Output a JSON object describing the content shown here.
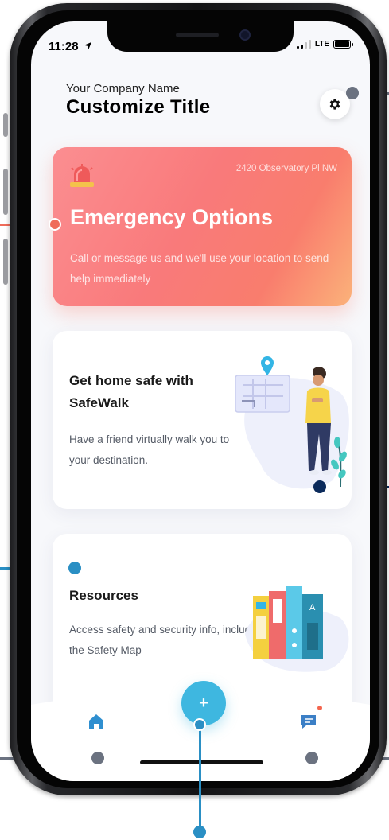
{
  "status_bar": {
    "time": "11:28",
    "network": "LTE",
    "location_arrow_icon": "location-arrow-icon"
  },
  "header": {
    "company_name": "Your Company Name",
    "title": "Customize Title",
    "settings_icon": "gear-icon"
  },
  "emergency_card": {
    "icon": "siren-icon",
    "address": "2420 Observatory Pl NW",
    "title": "Emergency Options",
    "description": "Call or message us and we'll use your location to send help immediately"
  },
  "safewalk_card": {
    "title": "Get home safe with SafeWalk",
    "description": "Have a friend virtually walk you to your destination.",
    "illustration": "person-with-phone-and-map-pin"
  },
  "resources_card": {
    "title": "Resources",
    "description": "Access safety and security info, including the Safety Map",
    "illustration": "binders-and-books"
  },
  "bottom_nav": {
    "home_icon": "home-icon",
    "add_icon": "plus-icon",
    "add_label": "+",
    "chat_icon": "chat-icon",
    "chat_has_notification": true
  },
  "colors": {
    "emergency_gradient_start": "#fb8e91",
    "emergency_gradient_end": "#fbb27a",
    "fab": "#3eb7e0",
    "notification_dot": "#f4664f",
    "callout_gray": "#6b7280",
    "callout_navy": "#0b2a5b",
    "callout_blue": "#2a8fc4",
    "callout_coral": "#ef6c5a"
  }
}
